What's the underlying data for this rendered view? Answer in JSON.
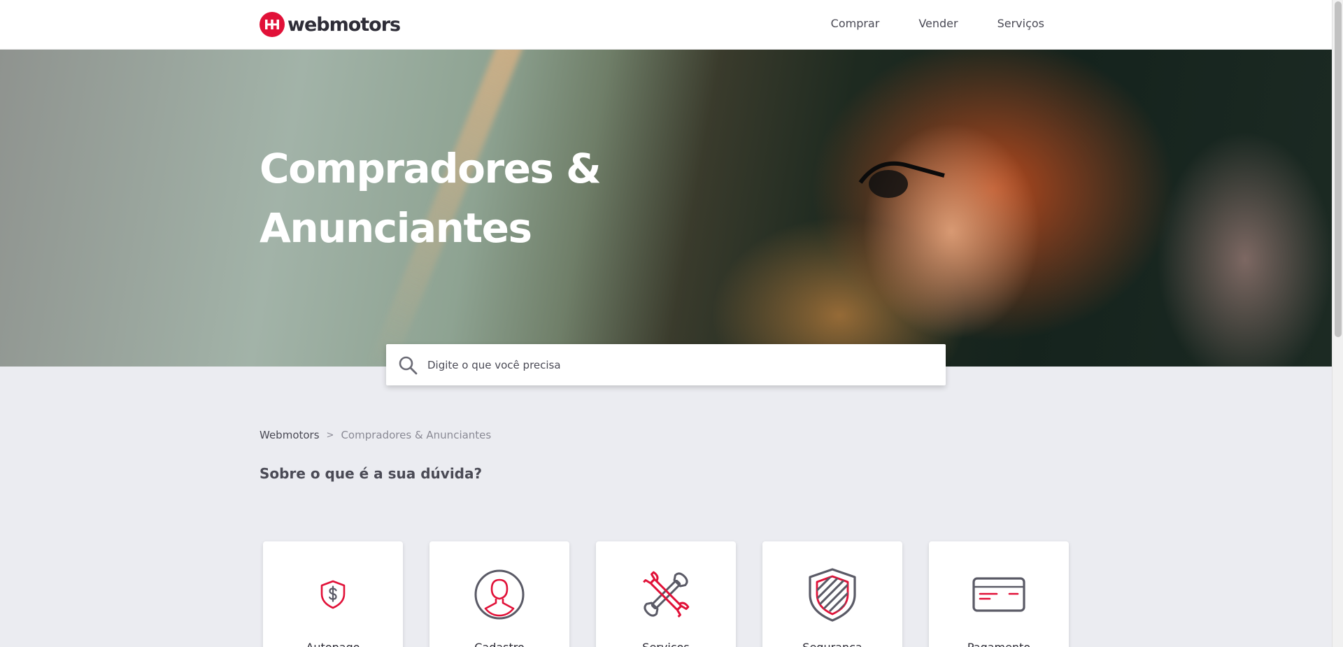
{
  "brand": {
    "name": "webmotors",
    "accent": "#e11138",
    "dark": "#2e2d37",
    "logo_icon": "webmotors-logo-icon"
  },
  "nav": {
    "items": [
      {
        "label": "Comprar"
      },
      {
        "label": "Vender"
      },
      {
        "label": "Serviços"
      }
    ]
  },
  "hero": {
    "title": "Compradores & Anunciantes"
  },
  "search": {
    "placeholder": "Digite o que você precisa",
    "value": "",
    "icon": "search-icon"
  },
  "breadcrumb": {
    "items": [
      {
        "label": "Webmotors"
      },
      {
        "label": "Compradores & Anunciantes"
      }
    ],
    "separator": ">"
  },
  "section": {
    "title": "Sobre o que é a sua dúvida?"
  },
  "categories": [
    {
      "label": "Autopago",
      "icon": "shield-dollar-icon"
    },
    {
      "label": "Cadastro",
      "icon": "user-profile-icon"
    },
    {
      "label": "Serviços",
      "icon": "wrench-tools-icon"
    },
    {
      "label": "Segurança",
      "icon": "security-shield-icon"
    },
    {
      "label": "Pagamento",
      "icon": "credit-card-icon"
    }
  ]
}
